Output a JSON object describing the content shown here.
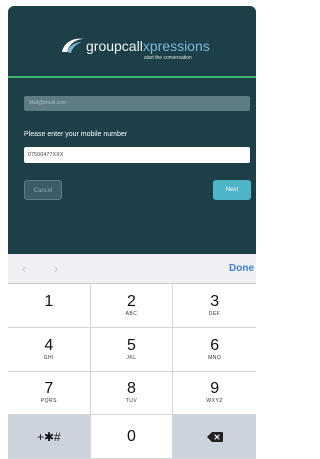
{
  "app": {
    "logo_white": "groupcall",
    "logo_blue": "xpressions",
    "tagline": "start the conversation",
    "email_placeholder": "Mail@email.com",
    "prompt": "Please enter your mobile number",
    "mobile_value": "07500477XXX",
    "cancel_label": "Cancel",
    "next_label": "Next"
  },
  "keyboard": {
    "prev_icon": "‹",
    "next_icon": "›",
    "done_label": "Done",
    "keys": [
      {
        "digit": "1",
        "letters": ""
      },
      {
        "digit": "2",
        "letters": "ABC"
      },
      {
        "digit": "3",
        "letters": "DEF"
      },
      {
        "digit": "4",
        "letters": "GHI"
      },
      {
        "digit": "5",
        "letters": "JKL"
      },
      {
        "digit": "6",
        "letters": "MNO"
      },
      {
        "digit": "7",
        "letters": "PQRS"
      },
      {
        "digit": "8",
        "letters": "TUV"
      },
      {
        "digit": "9",
        "letters": "WXYZ"
      }
    ],
    "symbols_label": "+✱#",
    "zero": "0"
  },
  "colors": {
    "app_background": "#1d3f47",
    "accent_green": "#3fb46a",
    "next_button": "#4eb4c7",
    "done_blue": "#3b7fd4"
  }
}
